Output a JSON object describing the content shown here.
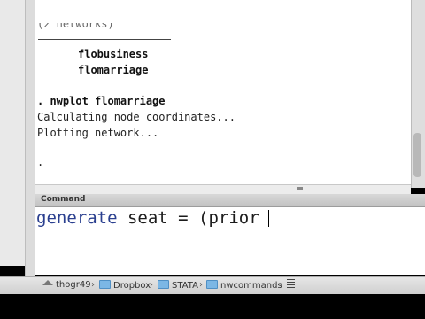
{
  "results": {
    "top_partial": "(2 networks)",
    "network_names": [
      "flobusiness",
      "flomarriage"
    ],
    "command_echo": ". nwplot flomarriage",
    "output_lines": [
      "Calculating node coordinates...",
      "Plotting network..."
    ],
    "prompt": "."
  },
  "command_panel": {
    "title": "Command",
    "input_keyword": "generate",
    "input_rest": " seat = (prior"
  },
  "pathbar": {
    "items": [
      {
        "label": "thogr49",
        "icon": "home-icon"
      },
      {
        "label": "Dropbox",
        "icon": "folder-icon"
      },
      {
        "label": "STATA",
        "icon": "folder-icon"
      },
      {
        "label": "nwcommands",
        "icon": "folder-icon"
      }
    ],
    "separator": "›",
    "overflow_icon": "menu-icon"
  }
}
